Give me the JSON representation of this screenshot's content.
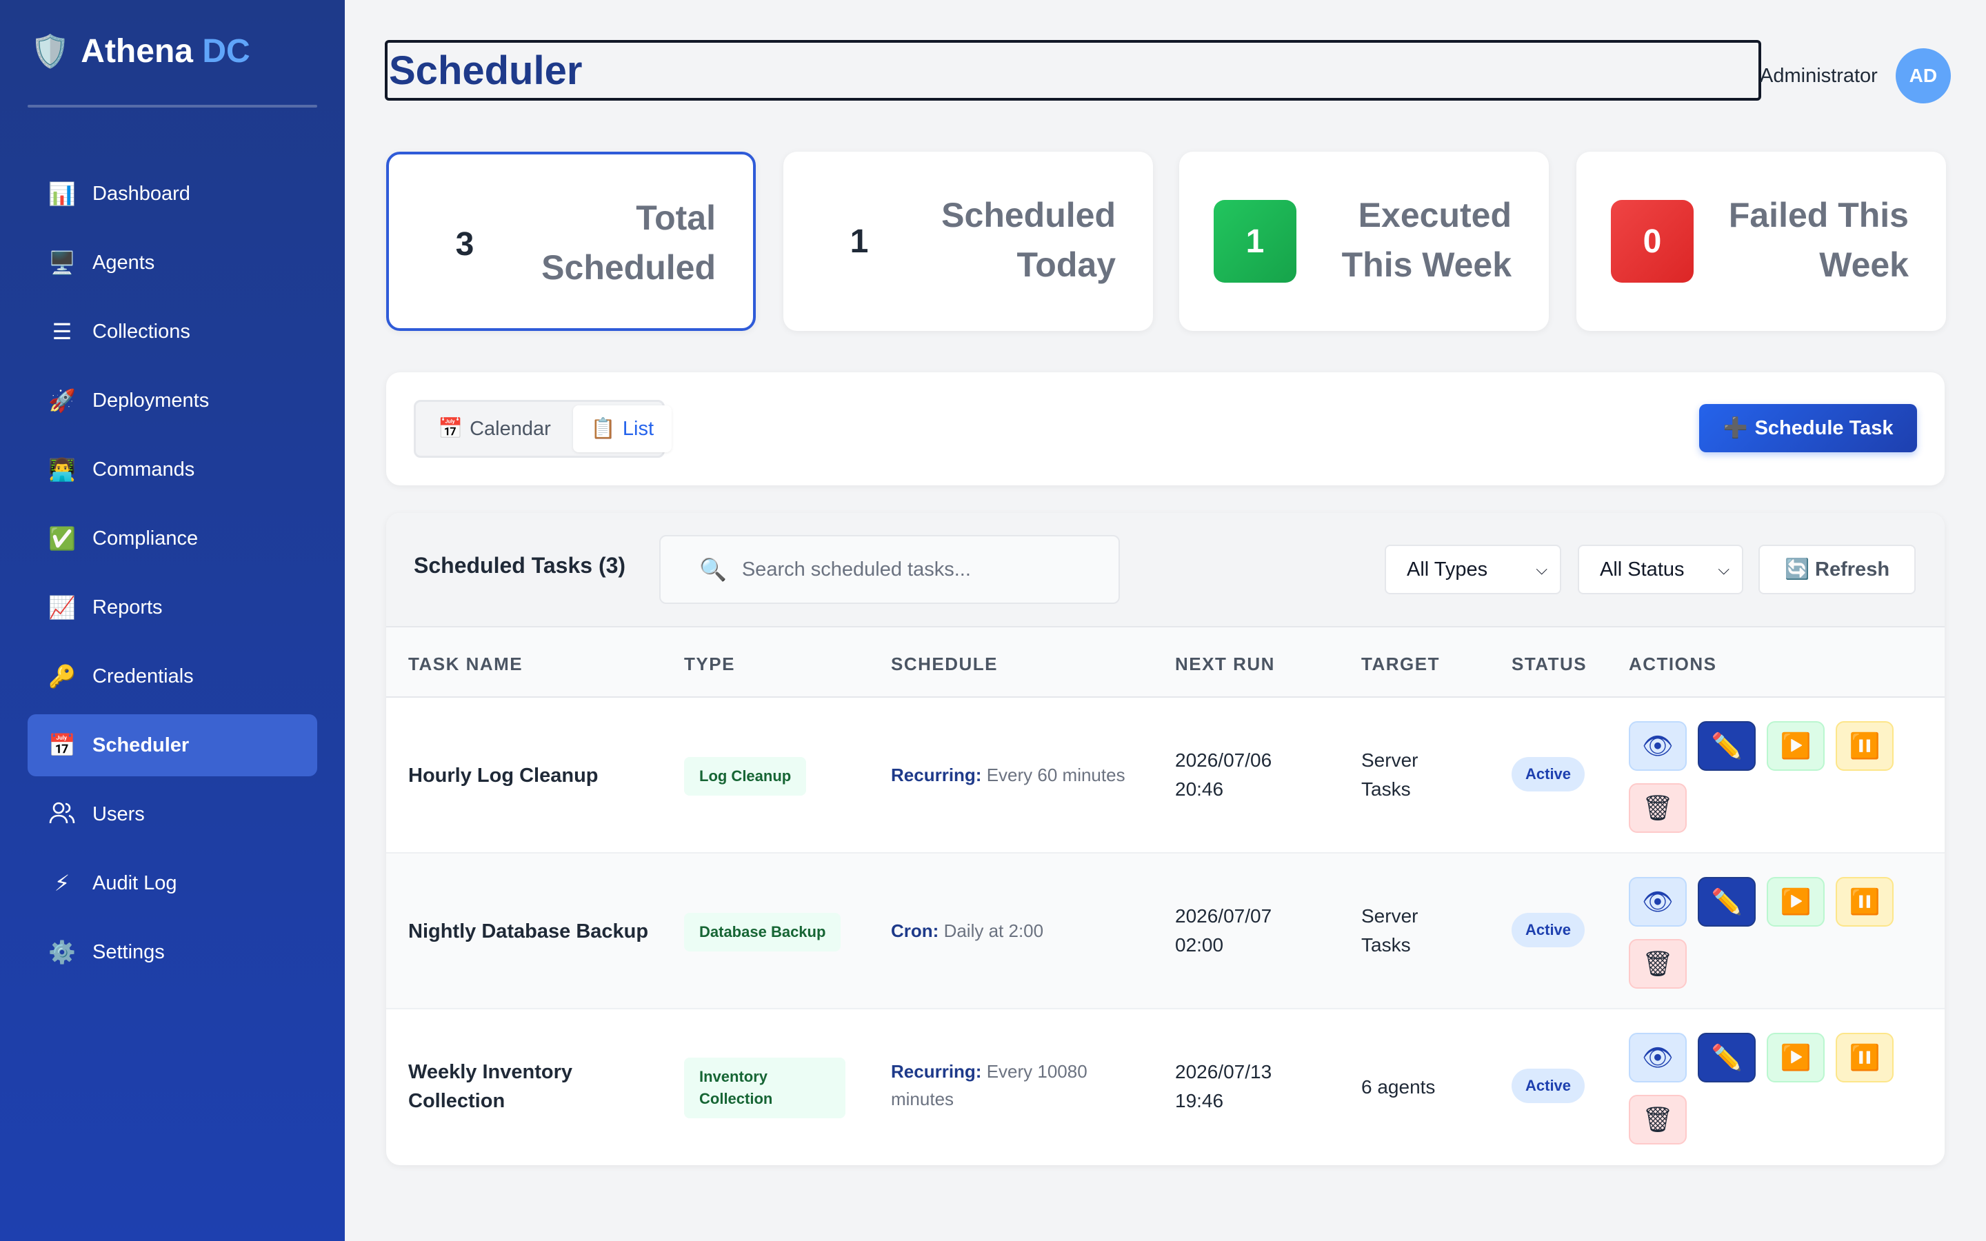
{
  "brand": {
    "name": "Athena",
    "accent": "DC",
    "logo_icon": "shield-icon"
  },
  "sidebar": {
    "items": [
      {
        "label": "Dashboard",
        "icon": "📊",
        "icon_name": "bar-chart-icon"
      },
      {
        "label": "Agents",
        "icon": "🖥️",
        "icon_name": "monitor-icon"
      },
      {
        "label": "Collections",
        "icon": "☰",
        "icon_name": "list-icon"
      },
      {
        "label": "Deployments",
        "icon": "🚀",
        "icon_name": "rocket-icon"
      },
      {
        "label": "Commands",
        "icon": "👨‍💻",
        "icon_name": "technologist-icon"
      },
      {
        "label": "Compliance",
        "icon": "✅",
        "icon_name": "check-icon"
      },
      {
        "label": "Reports",
        "icon": "📈",
        "icon_name": "trend-chart-icon"
      },
      {
        "label": "Credentials",
        "icon": "🔑",
        "icon_name": "key-icon"
      },
      {
        "label": "Scheduler",
        "icon": "📅",
        "icon_name": "calendar-icon",
        "active": true
      },
      {
        "label": "Users",
        "icon": "👥",
        "icon_name": "users-icon"
      },
      {
        "label": "Audit Log",
        "icon": "⚡",
        "icon_name": "lightning-icon"
      },
      {
        "label": "Settings",
        "icon": "⚙️",
        "icon_name": "gear-icon"
      }
    ]
  },
  "header": {
    "title": "Scheduler",
    "user_name": "Administrator",
    "user_initials": "AD"
  },
  "stats": [
    {
      "value": "3",
      "label": "Total Scheduled",
      "style": "plain",
      "selected": true
    },
    {
      "value": "1",
      "label": "Scheduled Today",
      "style": "plain"
    },
    {
      "value": "1",
      "label": "Executed This Week",
      "style": "green"
    },
    {
      "value": "0",
      "label": "Failed This Week",
      "style": "red"
    }
  ],
  "toolbar": {
    "calendar_label": "Calendar",
    "calendar_icon": "📅",
    "list_label": "List",
    "list_icon": "📋",
    "active_view": "List",
    "schedule_label": "Schedule Task",
    "schedule_icon": "➕"
  },
  "table": {
    "title": "Scheduled Tasks (3)",
    "search_placeholder": "Search scheduled tasks...",
    "search_icon": "🔍",
    "type_filter": "All Types",
    "status_filter": "All Status",
    "refresh_label": "Refresh",
    "refresh_icon": "🔄",
    "columns": [
      "TASK NAME",
      "TYPE",
      "SCHEDULE",
      "NEXT RUN",
      "TARGET",
      "STATUS",
      "ACTIONS"
    ],
    "rows": [
      {
        "name": "Hourly Log Cleanup",
        "type": "Log Cleanup",
        "schedule_kind": "Recurring:",
        "schedule_detail": "Every 60 minutes",
        "next_run": "2026/07/06 20:46",
        "target": "Server Tasks",
        "status": "Active"
      },
      {
        "name": "Nightly Database Backup",
        "type": "Database Backup",
        "schedule_kind": "Cron:",
        "schedule_detail": "Daily at 2:00",
        "next_run": "2026/07/07 02:00",
        "target": "Server Tasks",
        "status": "Active"
      },
      {
        "name": "Weekly Inventory Collection",
        "type": "Inventory Collection",
        "schedule_kind": "Recurring:",
        "schedule_detail": "Every 10080 minutes",
        "next_run": "2026/07/13 19:46",
        "target": "6 agents",
        "status": "Active"
      }
    ],
    "action_icons": {
      "view": "👁",
      "edit": "✏️",
      "run": "▶️",
      "pause": "⏸️",
      "delete": "🗑"
    }
  },
  "colors": {
    "sidebar_bg": "#1e40af",
    "accent": "#2563eb",
    "brand_accent": "#60a5fa",
    "success": "#16a34a",
    "danger": "#dc2626"
  }
}
